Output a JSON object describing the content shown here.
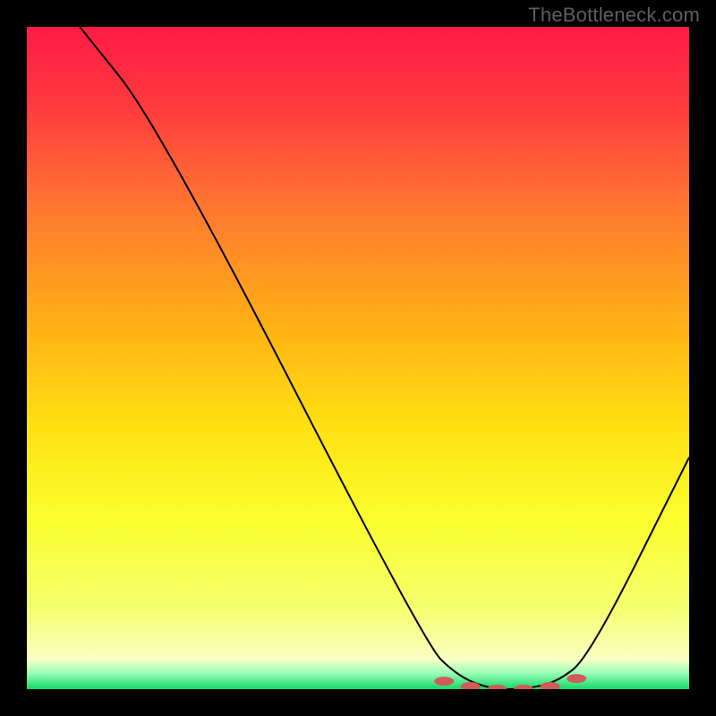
{
  "watermark": "TheBottleneck.com",
  "chart_data": {
    "type": "line",
    "title": "",
    "xlabel": "",
    "ylabel": "",
    "xlim": [
      0,
      100
    ],
    "ylim": [
      0,
      100
    ],
    "grid": false,
    "legend": false,
    "series": [
      {
        "name": "curve",
        "x": [
          8,
          20,
          60,
          65,
          70,
          75,
          80,
          85,
          100
        ],
        "y": [
          100,
          85,
          7,
          2,
          0,
          0,
          1,
          5,
          35
        ]
      }
    ],
    "markers": {
      "name": "sweet-spot",
      "x": [
        63,
        67,
        71,
        75,
        79,
        83
      ],
      "y": [
        1.2,
        0.4,
        0,
        0,
        0.4,
        1.6
      ],
      "color": "#d15a5a"
    },
    "background": {
      "type": "vertical-gradient",
      "stops": [
        {
          "offset": 0.0,
          "color": "#ff1a45"
        },
        {
          "offset": 0.12,
          "color": "#ff3a3e"
        },
        {
          "offset": 0.28,
          "color": "#ff7a30"
        },
        {
          "offset": 0.45,
          "color": "#ffb015"
        },
        {
          "offset": 0.6,
          "color": "#ffe012"
        },
        {
          "offset": 0.75,
          "color": "#fbff2f"
        },
        {
          "offset": 0.88,
          "color": "#f4ff70"
        },
        {
          "offset": 0.955,
          "color": "#faffc3"
        },
        {
          "offset": 0.975,
          "color": "#9dffb8"
        },
        {
          "offset": 1.0,
          "color": "#12d86a"
        }
      ]
    }
  }
}
